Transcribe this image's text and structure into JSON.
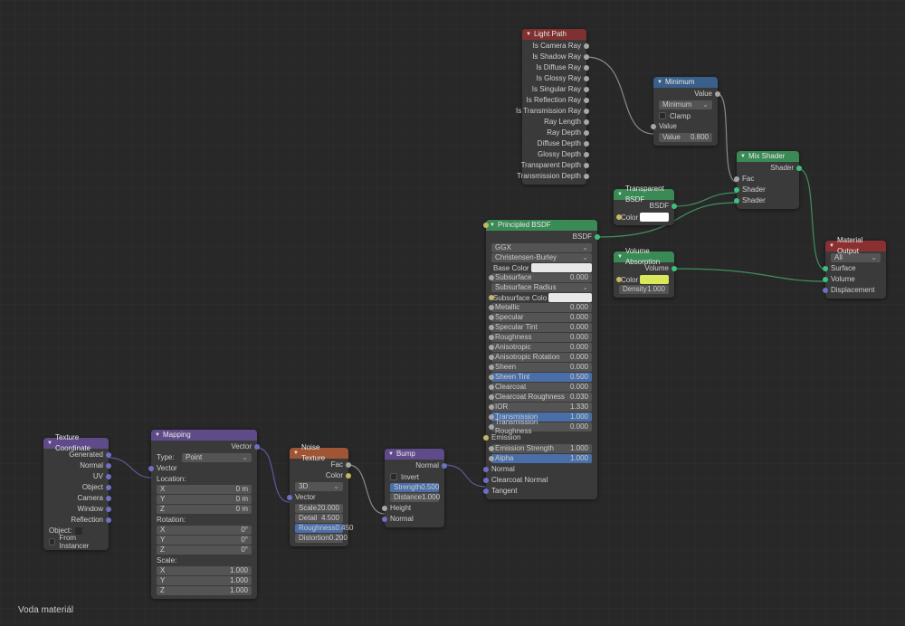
{
  "footer": "Voda materiál",
  "nodes": {
    "texcoord": {
      "title": "Texture Coordinate",
      "outputs": [
        "Generated",
        "Normal",
        "UV",
        "Object",
        "Camera",
        "Window",
        "Reflection"
      ],
      "object_label": "Object:",
      "from_instancer": "From Instancer"
    },
    "mapping": {
      "title": "Mapping",
      "out": "Vector",
      "type_label": "Type:",
      "type_value": "Point",
      "in_vector": "Vector",
      "loc_label": "Location:",
      "loc": {
        "X": "0 m",
        "Y": "0 m",
        "Z": "0 m"
      },
      "rot_label": "Rotation:",
      "rot": {
        "X": "0°",
        "Y": "0°",
        "Z": "0°"
      },
      "scale_label": "Scale:",
      "scale": {
        "X": "1.000",
        "Y": "1.000",
        "Z": "1.000"
      }
    },
    "noise": {
      "title": "Noise Texture",
      "out_fac": "Fac",
      "out_color": "Color",
      "dim": "3D",
      "in_vector": "Vector",
      "params": {
        "scale_l": "Scale",
        "scale_v": "20.000",
        "detail_l": "Detail",
        "detail_v": "4.500",
        "rough_l": "Roughness",
        "rough_v": "0.450",
        "dist_l": "Distortion",
        "dist_v": "0.200"
      }
    },
    "bump": {
      "title": "Bump",
      "out_normal": "Normal",
      "invert": "Invert",
      "strength_l": "Strength",
      "strength_v": "0.500",
      "distance_l": "Distance",
      "distance_v": "1.000",
      "in_height": "Height",
      "in_normal": "Normal"
    },
    "principled": {
      "title": "Principled BSDF",
      "out": "BSDF",
      "dist": "GGX",
      "sss_method": "Christensen-Burley",
      "base_color_l": "Base Color",
      "rows": [
        {
          "l": "Subsurface",
          "v": "0.000",
          "t": "val"
        },
        {
          "l": "Subsurface Radius",
          "t": "drop"
        },
        {
          "l": "Subsurface Colo",
          "t": "color",
          "c": "#e8e8e8"
        },
        {
          "l": "Metallic",
          "v": "0.000",
          "t": "val"
        },
        {
          "l": "Specular",
          "v": "0.000",
          "t": "val"
        },
        {
          "l": "Specular Tint",
          "v": "0.000",
          "t": "val"
        },
        {
          "l": "Roughness",
          "v": "0.000",
          "t": "val"
        },
        {
          "l": "Anisotropic",
          "v": "0.000",
          "t": "val"
        },
        {
          "l": "Anisotropic Rotation",
          "v": "0.000",
          "t": "val"
        },
        {
          "l": "Sheen",
          "v": "0.000",
          "t": "val"
        },
        {
          "l": "Sheen Tint",
          "v": "0.500",
          "t": "blue"
        },
        {
          "l": "Clearcoat",
          "v": "0.000",
          "t": "val"
        },
        {
          "l": "Clearcoat Roughness",
          "v": "0.030",
          "t": "val"
        },
        {
          "l": "IOR",
          "v": "1.330",
          "t": "val"
        },
        {
          "l": "Transmission",
          "v": "1.000",
          "t": "blue"
        },
        {
          "l": "Transmission Roughness",
          "v": "0.000",
          "t": "val"
        },
        {
          "l": "Emission",
          "t": "plain"
        },
        {
          "l": "Emission Strength",
          "v": "1.000",
          "t": "val"
        },
        {
          "l": "Alpha",
          "v": "1.000",
          "t": "blue"
        }
      ],
      "tail": [
        "Normal",
        "Clearcoat Normal",
        "Tangent"
      ]
    },
    "lightpath": {
      "title": "Light Path",
      "outputs": [
        "Is Camera Ray",
        "Is Shadow Ray",
        "Is Diffuse Ray",
        "Is Glossy Ray",
        "Is Singular Ray",
        "Is Reflection Ray",
        "Is Transmission Ray",
        "Ray Length",
        "Ray Depth",
        "Diffuse Depth",
        "Glossy Depth",
        "Transparent Depth",
        "Transmission Depth"
      ]
    },
    "minimum": {
      "title": "Minimum",
      "out": "Value",
      "op": "Minimum",
      "clamp": "Clamp",
      "in_value": "Value",
      "field_l": "Value",
      "field_v": "0.800"
    },
    "mix": {
      "title": "Mix Shader",
      "out": "Shader",
      "ins": [
        "Fac",
        "Shader",
        "Shader"
      ]
    },
    "transparent": {
      "title": "Transparent BSDF",
      "out": "BSDF",
      "color_l": "Color"
    },
    "volabs": {
      "title": "Volume Absorption",
      "out": "Volume",
      "color_l": "Color",
      "density_l": "Density",
      "density_v": "1.000"
    },
    "output": {
      "title": "Material Output",
      "target": "All",
      "ins": [
        "Surface",
        "Volume",
        "Displacement"
      ]
    }
  }
}
